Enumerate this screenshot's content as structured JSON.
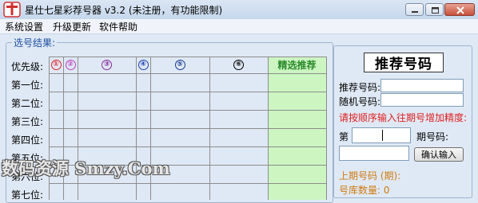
{
  "window": {
    "title": "星仕七星彩荐号器 v3.2 (未注册，有功能限制)"
  },
  "menu": [
    {
      "label": "系统设置"
    },
    {
      "label": "升级更新"
    },
    {
      "label": "软件帮助"
    }
  ],
  "results": {
    "group_label": "选号结果:",
    "priority_label": "优先级:",
    "columns": [
      {
        "label": "①",
        "color": "#e0202a"
      },
      {
        "label": "②",
        "color": "#c040c0"
      },
      {
        "label": "③",
        "color": "#8a2a9a"
      },
      {
        "label": "④",
        "color": "#2040b0"
      },
      {
        "label": "⑤",
        "color": "#1a3a90"
      },
      {
        "label": "⑥",
        "color": "#000000"
      }
    ],
    "featured_label": "精选推荐",
    "featured_color": "#2a8a2a",
    "featured_bg": "#ccf5c2",
    "rows": [
      "第一位:",
      "第二位:",
      "第三位:",
      "第四位:",
      "第五位:",
      "第六位:",
      "第七位:"
    ]
  },
  "panel": {
    "recommend_button": "推荐号码",
    "recommend_code_label": "推荐号码:",
    "random_code_label": "随机号码:",
    "hint": "请按顺序输入往期号增加精度:",
    "hint_color": "#e02020",
    "period_prefix": "第",
    "period_label": "期号码:",
    "confirm_button": "确认输入",
    "last_period_label": "上期号码 (期):",
    "pool_count_label": "号库数量: 0",
    "info_color": "#d07a10"
  },
  "watermark": "数码资源 Smzy.Com"
}
